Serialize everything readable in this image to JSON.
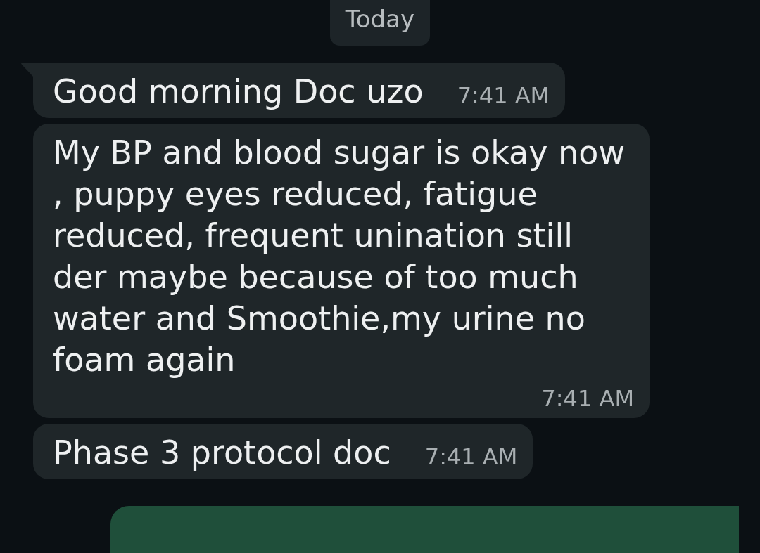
{
  "date_chip": "Today",
  "messages": [
    {
      "kind": "incoming",
      "text": "Good morning Doc uzo",
      "time": "7:41 AM",
      "tail": true
    },
    {
      "kind": "incoming",
      "text": "My BP and blood sugar is okay now , puppy eyes reduced, fatigue reduced, frequent unination still der maybe because of too much water and Smoothie,my urine no foam again",
      "time": "7:41 AM",
      "tail": false
    },
    {
      "kind": "incoming",
      "text": "Phase 3 protocol doc",
      "time": "7:41 AM",
      "tail": false
    },
    {
      "kind": "outgoing"
    }
  ]
}
